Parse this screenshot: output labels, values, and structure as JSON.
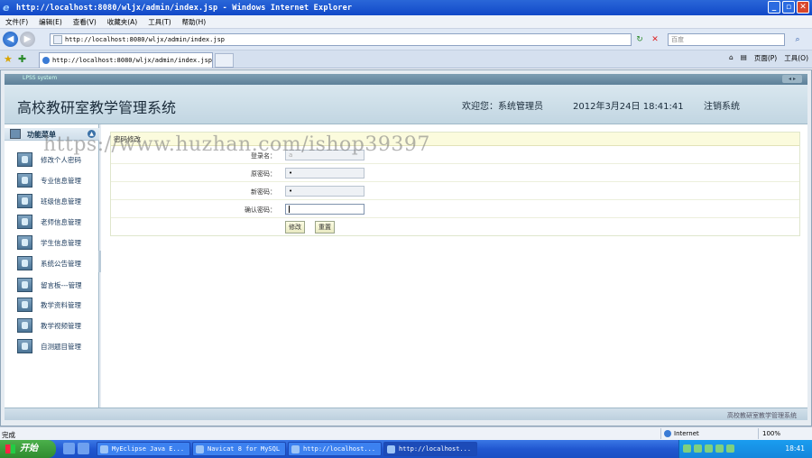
{
  "browser": {
    "title": "http://localhost:8080/wljx/admin/index.jsp - Windows Internet Explorer",
    "menu": [
      "文件(F)",
      "编辑(E)",
      "查看(V)",
      "收藏夹(A)",
      "工具(T)",
      "帮助(H)"
    ],
    "address": "http://localhost:8080/wljx/admin/index.jsp",
    "search_placeholder": "百度",
    "tab_title": "http://localhost:8080/wljx/admin/index.jsp",
    "commands": [
      "页面(P)",
      "工具(O)"
    ],
    "status_left": "完成",
    "zone": "Internet",
    "zoom": "100%"
  },
  "app": {
    "top_strip_label": "LPSS system",
    "title": "高校教研室教学管理系统",
    "welcome": "欢迎您：系统管理员",
    "datetime": "2012年3月24日  18:41:41",
    "logout": "注销系统",
    "footer": "高校教研室教学管理系统"
  },
  "sidebar": {
    "header": "功能菜单",
    "items": [
      {
        "label": "修改个人密码"
      },
      {
        "label": "专业信息管理"
      },
      {
        "label": "班级信息管理"
      },
      {
        "label": "老师信息管理"
      },
      {
        "label": "学生信息管理"
      },
      {
        "label": "系统公告管理"
      },
      {
        "label": "留言板---管理"
      },
      {
        "label": "教学资料管理"
      },
      {
        "label": "教学视频管理"
      },
      {
        "label": "自测题目管理"
      }
    ]
  },
  "form": {
    "title": "密码修改",
    "fields": [
      {
        "label": "登录名：",
        "value": "a"
      },
      {
        "label": "原密码：",
        "value": "•"
      },
      {
        "label": "新密码：",
        "value": "•"
      },
      {
        "label": "确认密码：",
        "value": ""
      }
    ],
    "submit": "修改",
    "reset": "重置"
  },
  "watermark": "https://www.huzhan.com/ishop39397",
  "taskbar": {
    "start": "开始",
    "tasks": [
      "MyEclipse Java E...",
      "Navicat 8 for MySQL",
      "http://localhost...",
      "http://localhost..."
    ],
    "clock": "18:41"
  }
}
